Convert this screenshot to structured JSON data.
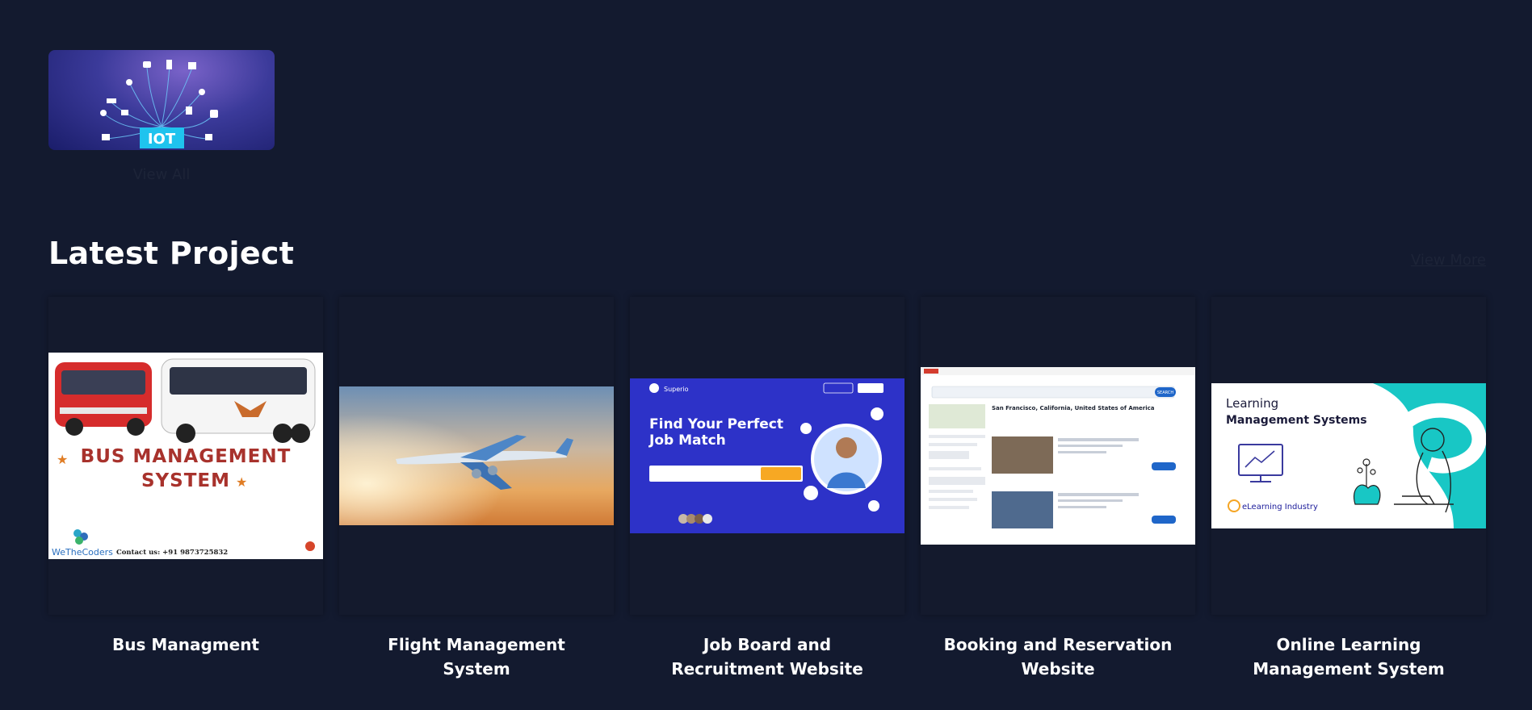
{
  "featured": {
    "badge_text": "IOT",
    "view_all_label": "View All"
  },
  "section": {
    "title": "Latest Project",
    "view_more_label": "View More"
  },
  "projects": [
    {
      "title": "Bus Managment",
      "image": {
        "heading_line1": "BUS MANAGEMENT",
        "heading_line2": "SYSTEM",
        "brand": "WeTheCoders",
        "contact": "Contact us: +91 9873725832"
      }
    },
    {
      "title": "Flight Management System",
      "image": {}
    },
    {
      "title": "Job Board and Recruitment Website",
      "image": {
        "logo": "Superio",
        "heading_line1": "Find Your Perfect",
        "heading_line2": "Job Match"
      }
    },
    {
      "title": "Booking and Reservation Website",
      "image": {
        "heading": "San Francisco, California, United States of America",
        "button": "SEARCH"
      }
    },
    {
      "title": "Online Learning Management System",
      "image": {
        "line1": "Learning",
        "line2": "Management Systems",
        "brand": "eLearning Industry"
      }
    }
  ],
  "colors": {
    "page_bg": "#131a2f",
    "accent_teal": "#18c7c5",
    "job_board_blue": "#2d32c8",
    "bus_red": "#a8322c"
  }
}
